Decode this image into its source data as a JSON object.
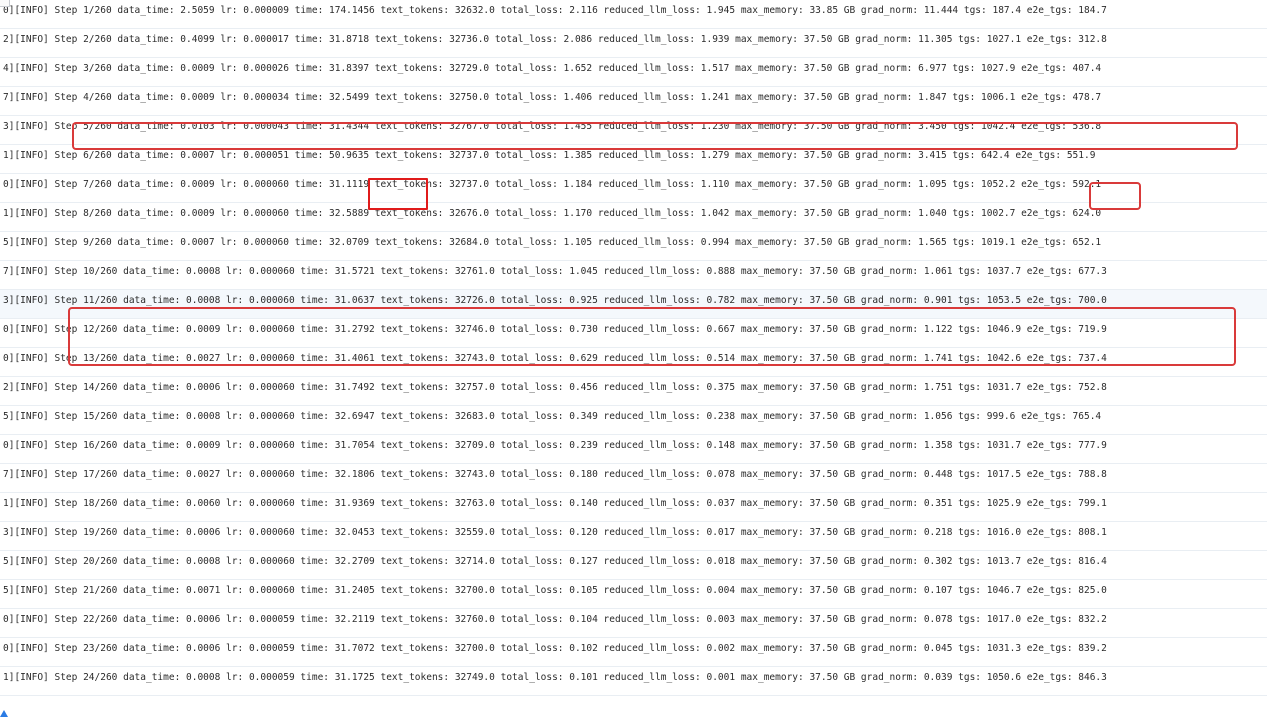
{
  "log": {
    "lines": [
      "0][INFO] Step 1/260 data_time: 2.5059 lr: 0.000009 time: 174.1456 text_tokens: 32632.0 total_loss: 2.116 reduced_llm_loss: 1.945 max_memory: 33.85 GB grad_norm: 11.444 tgs: 187.4 e2e_tgs: 184.7",
      "2][INFO] Step 2/260 data_time: 0.4099 lr: 0.000017 time: 31.8718 text_tokens: 32736.0 total_loss: 2.086 reduced_llm_loss: 1.939 max_memory: 37.50 GB grad_norm: 11.305 tgs: 1027.1 e2e_tgs: 312.8",
      "4][INFO] Step 3/260 data_time: 0.0009 lr: 0.000026 time: 31.8397 text_tokens: 32729.0 total_loss: 1.652 reduced_llm_loss: 1.517 max_memory: 37.50 GB grad_norm: 6.977 tgs: 1027.9 e2e_tgs: 407.4",
      "7][INFO] Step 4/260 data_time: 0.0009 lr: 0.000034 time: 32.5499 text_tokens: 32750.0 total_loss: 1.406 reduced_llm_loss: 1.241 max_memory: 37.50 GB grad_norm: 1.847 tgs: 1006.1 e2e_tgs: 478.7",
      "3][INFO] Step 5/260 data_time: 0.0103 lr: 0.000043 time: 31.4344 text_tokens: 32767.0 total_loss: 1.455 reduced_llm_loss: 1.230 max_memory: 37.50 GB grad_norm: 3.450 tgs: 1042.4 e2e_tgs: 536.8",
      "1][INFO] Step 6/260 data_time: 0.0007 lr: 0.000051 time: 50.9635 text_tokens: 32737.0 total_loss: 1.385 reduced_llm_loss: 1.279 max_memory: 37.50 GB grad_norm: 3.415 tgs: 642.4 e2e_tgs: 551.9",
      "0][INFO] Step 7/260 data_time: 0.0009 lr: 0.000060 time: 31.1119 text_tokens: 32737.0 total_loss: 1.184 reduced_llm_loss: 1.110 max_memory: 37.50 GB grad_norm: 1.095 tgs: 1052.2 e2e_tgs: 592.1",
      "1][INFO] Step 8/260 data_time: 0.0009 lr: 0.000060 time: 32.5889 text_tokens: 32676.0 total_loss: 1.170 reduced_llm_loss: 1.042 max_memory: 37.50 GB grad_norm: 1.040 tgs: 1002.7 e2e_tgs: 624.0",
      "5][INFO] Step 9/260 data_time: 0.0007 lr: 0.000060 time: 32.0709 text_tokens: 32684.0 total_loss: 1.105 reduced_llm_loss: 0.994 max_memory: 37.50 GB grad_norm: 1.565 tgs: 1019.1 e2e_tgs: 652.1",
      "7][INFO] Step 10/260 data_time: 0.0008 lr: 0.000060 time: 31.5721 text_tokens: 32761.0 total_loss: 1.045 reduced_llm_loss: 0.888 max_memory: 37.50 GB grad_norm: 1.061 tgs: 1037.7 e2e_tgs: 677.3",
      "3][INFO] Step 11/260 data_time: 0.0008 lr: 0.000060 time: 31.0637 text_tokens: 32726.0 total_loss: 0.925 reduced_llm_loss: 0.782 max_memory: 37.50 GB grad_norm: 0.901 tgs: 1053.5 e2e_tgs: 700.0",
      "0][INFO] Step 12/260 data_time: 0.0009 lr: 0.000060 time: 31.2792 text_tokens: 32746.0 total_loss: 0.730 reduced_llm_loss: 0.667 max_memory: 37.50 GB grad_norm: 1.122 tgs: 1046.9 e2e_tgs: 719.9",
      "0][INFO] Step 13/260 data_time: 0.0027 lr: 0.000060 time: 31.4061 text_tokens: 32743.0 total_loss: 0.629 reduced_llm_loss: 0.514 max_memory: 37.50 GB grad_norm: 1.741 tgs: 1042.6 e2e_tgs: 737.4",
      "2][INFO] Step 14/260 data_time: 0.0006 lr: 0.000060 time: 31.7492 text_tokens: 32757.0 total_loss: 0.456 reduced_llm_loss: 0.375 max_memory: 37.50 GB grad_norm: 1.751 tgs: 1031.7 e2e_tgs: 752.8",
      "5][INFO] Step 15/260 data_time: 0.0008 lr: 0.000060 time: 32.6947 text_tokens: 32683.0 total_loss: 0.349 reduced_llm_loss: 0.238 max_memory: 37.50 GB grad_norm: 1.056 tgs: 999.6 e2e_tgs: 765.4",
      "0][INFO] Step 16/260 data_time: 0.0009 lr: 0.000060 time: 31.7054 text_tokens: 32709.0 total_loss: 0.239 reduced_llm_loss: 0.148 max_memory: 37.50 GB grad_norm: 1.358 tgs: 1031.7 e2e_tgs: 777.9",
      "7][INFO] Step 17/260 data_time: 0.0027 lr: 0.000060 time: 32.1806 text_tokens: 32743.0 total_loss: 0.180 reduced_llm_loss: 0.078 max_memory: 37.50 GB grad_norm: 0.448 tgs: 1017.5 e2e_tgs: 788.8",
      "1][INFO] Step 18/260 data_time: 0.0060 lr: 0.000060 time: 31.9369 text_tokens: 32763.0 total_loss: 0.140 reduced_llm_loss: 0.037 max_memory: 37.50 GB grad_norm: 0.351 tgs: 1025.9 e2e_tgs: 799.1",
      "3][INFO] Step 19/260 data_time: 0.0006 lr: 0.000060 time: 32.0453 text_tokens: 32559.0 total_loss: 0.120 reduced_llm_loss: 0.017 max_memory: 37.50 GB grad_norm: 0.218 tgs: 1016.0 e2e_tgs: 808.1",
      "5][INFO] Step 20/260 data_time: 0.0008 lr: 0.000060 time: 32.2709 text_tokens: 32714.0 total_loss: 0.127 reduced_llm_loss: 0.018 max_memory: 37.50 GB grad_norm: 0.302 tgs: 1013.7 e2e_tgs: 816.4",
      "5][INFO] Step 21/260 data_time: 0.0071 lr: 0.000060 time: 31.2405 text_tokens: 32700.0 total_loss: 0.105 reduced_llm_loss: 0.004 max_memory: 37.50 GB grad_norm: 0.107 tgs: 1046.7 e2e_tgs: 825.0",
      "0][INFO] Step 22/260 data_time: 0.0006 lr: 0.000059 time: 32.2119 text_tokens: 32760.0 total_loss: 0.104 reduced_llm_loss: 0.003 max_memory: 37.50 GB grad_norm: 0.078 tgs: 1017.0 e2e_tgs: 832.2",
      "0][INFO] Step 23/260 data_time: 0.0006 lr: 0.000059 time: 31.7072 text_tokens: 32700.0 total_loss: 0.102 reduced_llm_loss: 0.002 max_memory: 37.50 GB grad_norm: 0.045 tgs: 1031.3 e2e_tgs: 839.2",
      "1][INFO] Step 24/260 data_time: 0.0008 lr: 0.000059 time: 31.1725 text_tokens: 32749.0 total_loss: 0.101 reduced_llm_loss: 0.001 max_memory: 37.50 GB grad_norm: 0.039 tgs: 1050.6 e2e_tgs: 846.3"
    ]
  },
  "highlight": {
    "box_color": "#d93a3a",
    "row_tint": "#f4f8fc"
  }
}
